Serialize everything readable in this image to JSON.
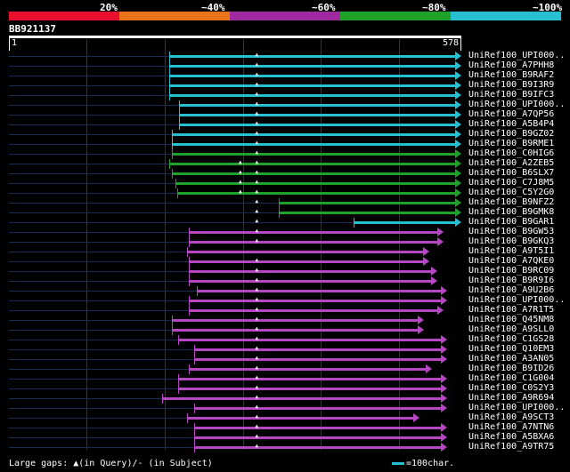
{
  "scale": {
    "labels": [
      "20%",
      "~40%",
      "~60%",
      "~80%",
      "~100%"
    ],
    "colors": [
      "#e8102c",
      "#e8731a",
      "#9f2a9f",
      "#1ea22a",
      "#27c0d3"
    ]
  },
  "query": {
    "id": "BB921137",
    "start": "1",
    "end": "578",
    "length": 578
  },
  "colors": {
    "cyan": "#27c0d3",
    "green": "#1ea22a",
    "purple": "#b646c4",
    "track": "#1a2a55"
  },
  "hits": [
    {
      "name": "UniRef100_UPI000..",
      "color": "cyan",
      "start": 205,
      "gaps": [
        318
      ]
    },
    {
      "name": "UniRef100_A7PHH8",
      "color": "cyan",
      "start": 205,
      "gaps": [
        318
      ]
    },
    {
      "name": "UniRef100_B9RAF2",
      "color": "cyan",
      "start": 205,
      "gaps": [
        318
      ]
    },
    {
      "name": "UniRef100_B9I3R9",
      "color": "cyan",
      "start": 205,
      "gaps": [
        318
      ]
    },
    {
      "name": "UniRef100_B9IFC3",
      "color": "cyan",
      "start": 205,
      "gaps": [
        318
      ]
    },
    {
      "name": "UniRef100_UPI000..",
      "color": "cyan",
      "start": 217,
      "gaps": [
        318
      ]
    },
    {
      "name": "UniRef100_A7QP56",
      "color": "cyan",
      "start": 217,
      "gaps": [
        318
      ]
    },
    {
      "name": "UniRef100_A5B4P4",
      "color": "cyan",
      "start": 217,
      "gaps": [
        318
      ]
    },
    {
      "name": "UniRef100_B9GZ02",
      "color": "cyan",
      "start": 208,
      "gaps": [
        318
      ]
    },
    {
      "name": "UniRef100_B9RME1",
      "color": "cyan",
      "start": 208,
      "gaps": [
        318
      ]
    },
    {
      "name": "UniRef100_C0HIG6",
      "color": "green",
      "start": 208,
      "gaps": [
        318
      ]
    },
    {
      "name": "UniRef100_A2ZEB5",
      "color": "green",
      "start": 205,
      "gaps": [
        297,
        318
      ]
    },
    {
      "name": "UniRef100_B6SLX7",
      "color": "green",
      "start": 208,
      "gaps": [
        297,
        318
      ]
    },
    {
      "name": "UniRef100_C7J8M5",
      "color": "green",
      "start": 213,
      "gaps": [
        297,
        318
      ]
    },
    {
      "name": "UniRef100_C5Y2G0",
      "color": "green",
      "start": 215,
      "gaps": [
        297,
        318
      ]
    },
    {
      "name": "UniRef100_B9NFZ2",
      "color": "green",
      "start": 345,
      "gaps": [
        318
      ]
    },
    {
      "name": "UniRef100_B9GMK8",
      "color": "green",
      "start": 345,
      "gaps": [
        318
      ]
    },
    {
      "name": "UniRef100_B9GAR1",
      "color": "cyan",
      "start": 440,
      "gaps": [
        318
      ]
    },
    {
      "name": "UniRef100_B9GW53",
      "color": "purple",
      "start": 230,
      "gaps": [
        318
      ],
      "end": 555
    },
    {
      "name": "UniRef100_B9GKQ3",
      "color": "purple",
      "start": 230,
      "gaps": [
        318
      ],
      "end": 555
    },
    {
      "name": "UniRef100_A9T5I1",
      "color": "purple",
      "start": 228,
      "gaps": [],
      "end": 537
    },
    {
      "name": "UniRef100_A7QKE0",
      "color": "purple",
      "start": 230,
      "gaps": [
        318
      ],
      "end": 537
    },
    {
      "name": "UniRef100_B9RC09",
      "color": "purple",
      "start": 230,
      "gaps": [
        318
      ],
      "end": 547
    },
    {
      "name": "UniRef100_B9R9I6",
      "color": "purple",
      "start": 230,
      "gaps": [
        318
      ],
      "end": 547
    },
    {
      "name": "UniRef100_A9U2B6",
      "color": "purple",
      "start": 240,
      "gaps": [
        318
      ],
      "end": 560
    },
    {
      "name": "UniRef100_UPI000..",
      "color": "purple",
      "start": 230,
      "gaps": [
        318
      ],
      "end": 560
    },
    {
      "name": "UniRef100_A7R1T5",
      "color": "purple",
      "start": 230,
      "gaps": [
        318
      ],
      "end": 555
    },
    {
      "name": "UniRef100_Q45NM8",
      "color": "purple",
      "start": 208,
      "gaps": [
        318
      ],
      "end": 530
    },
    {
      "name": "UniRef100_A9SLL0",
      "color": "purple",
      "start": 208,
      "gaps": [
        318
      ],
      "end": 530
    },
    {
      "name": "UniRef100_C1GS28",
      "color": "purple",
      "start": 216,
      "gaps": [
        318
      ],
      "end": 560
    },
    {
      "name": "UniRef100_Q10EM3",
      "color": "purple",
      "start": 237,
      "gaps": [
        318
      ],
      "end": 560
    },
    {
      "name": "UniRef100_A3AN05",
      "color": "purple",
      "start": 237,
      "gaps": [
        318
      ],
      "end": 560
    },
    {
      "name": "UniRef100_B9ID26",
      "color": "purple",
      "start": 230,
      "gaps": [
        318
      ],
      "end": 540
    },
    {
      "name": "UniRef100_C1G004",
      "color": "purple",
      "start": 216,
      "gaps": [
        318
      ],
      "end": 560
    },
    {
      "name": "UniRef100_C0S2Y3",
      "color": "purple",
      "start": 216,
      "gaps": [
        318
      ],
      "end": 560
    },
    {
      "name": "UniRef100_A9R694",
      "color": "purple",
      "start": 196,
      "gaps": [
        318
      ],
      "end": 560
    },
    {
      "name": "UniRef100_UPI000..",
      "color": "purple",
      "start": 237,
      "gaps": [
        318
      ],
      "end": 560
    },
    {
      "name": "UniRef100_A9SCT3",
      "color": "purple",
      "start": 227,
      "gaps": [
        318
      ],
      "end": 525
    },
    {
      "name": "UniRef100_A7NTN6",
      "color": "purple",
      "start": 237,
      "gaps": [
        318
      ],
      "end": 560
    },
    {
      "name": "UniRef100_A5BXA6",
      "color": "purple",
      "start": 237,
      "gaps": [
        318
      ],
      "end": 560
    },
    {
      "name": "UniRef100_A9TR75",
      "color": "purple",
      "start": 237,
      "gaps": [
        318
      ],
      "end": 560
    }
  ],
  "footer": {
    "gap_legend": "Large gaps: ▲(in Query)/- (in Subject)",
    "scale_legend": "=100char."
  }
}
